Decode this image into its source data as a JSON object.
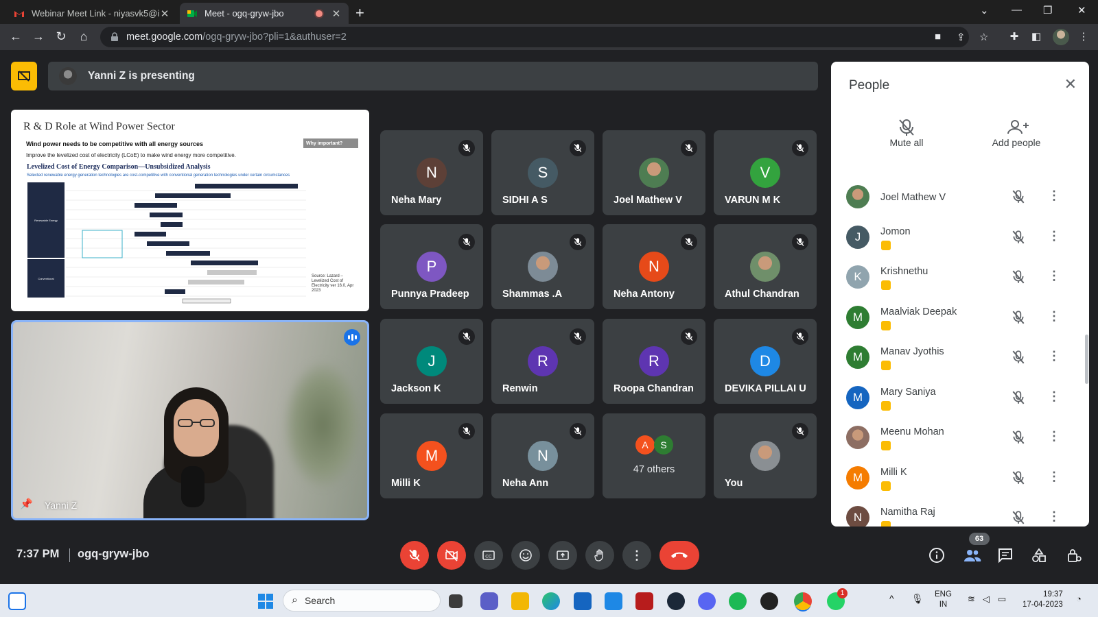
{
  "browser": {
    "tabs": [
      {
        "title": "Webinar Meet Link - niyasvk5@i",
        "active": false
      },
      {
        "title": "Meet - ogq-gryw-jbo",
        "active": true
      }
    ],
    "url_host": "meet.google.com",
    "url_path": "/ogq-gryw-jbo?pli=1&authuser=2"
  },
  "presenting": {
    "text": "Yanni Z is presenting"
  },
  "slide": {
    "title": "R & D Role at Wind Power Sector",
    "line1": "Wind power needs to be competitive with all energy sources",
    "line2": "Improve the levelized cost of electricity (LCoE) to make wind energy more competitive.",
    "chart_title": "Levelized Cost of Energy Comparison—Unsubsidized Analysis",
    "subtitle": "Selected renewable energy generation technologies are cost-competitive with conventional generation technologies under certain circumstances",
    "why_label": "Why important?",
    "source": "Source: Lazard – Levelized Cost of Electricity ver 16.0, Apr 2023",
    "cat_renewable": "Renewable Energy",
    "cat_conventional": "Conventional",
    "axis_label": "Levelized Cost of Energy ($/MWh)"
  },
  "presenter_tile": {
    "name": "Yanni Z"
  },
  "tiles": [
    {
      "name": "Neha Mary",
      "initial": "N",
      "color": "#5d4037",
      "muted": true
    },
    {
      "name": "SIDHI A S",
      "initial": "S",
      "color": "#455a64",
      "muted": true
    },
    {
      "name": "Joel Mathew V",
      "initial": "",
      "color": "#4e7d52",
      "muted": true,
      "photo": true
    },
    {
      "name": "VARUN M K",
      "initial": "V",
      "color": "#33a33e",
      "muted": true
    },
    {
      "name": "Punnya Pradeep",
      "initial": "P",
      "color": "#7e57c2",
      "muted": true
    },
    {
      "name": "Shammas .A",
      "initial": "",
      "color": "#7d8b96",
      "muted": true,
      "photo": true
    },
    {
      "name": "Neha Antony",
      "initial": "N",
      "color": "#e64a19",
      "muted": true
    },
    {
      "name": "Athul Chandran",
      "initial": "",
      "color": "#6f8f6a",
      "muted": true,
      "photo": true
    },
    {
      "name": "Jackson K",
      "initial": "J",
      "color": "#00897b",
      "muted": true
    },
    {
      "name": "Renwin",
      "initial": "R",
      "color": "#5e35b1",
      "muted": true
    },
    {
      "name": "Roopa Chandran",
      "initial": "R",
      "color": "#5e35b1",
      "muted": true
    },
    {
      "name": "DEVIKA PILLAI U",
      "initial": "D",
      "color": "#1e88e5",
      "muted": true
    },
    {
      "name": "Milli K",
      "initial": "M",
      "color": "#f4511e",
      "muted": true
    },
    {
      "name": "Neha Ann",
      "initial": "N",
      "color": "#78909c",
      "muted": true
    },
    {
      "name": "47 others",
      "initial": "",
      "color": "",
      "muted": false,
      "others": true,
      "others_initials": [
        "A",
        "S"
      ]
    },
    {
      "name": "You",
      "initial": "",
      "color": "#8a8f93",
      "muted": true,
      "photo": true
    }
  ],
  "people_panel": {
    "title": "People",
    "mute_all": "Mute all",
    "add_people": "Add people",
    "participants": [
      {
        "name": "Joel Mathew V",
        "initial": "",
        "color": "#4e7d52",
        "photo": true,
        "hand": false
      },
      {
        "name": "Jomon",
        "initial": "J",
        "color": "#455a64",
        "hand": true
      },
      {
        "name": "Krishnethu",
        "initial": "K",
        "color": "#90a4ae",
        "hand": true
      },
      {
        "name": "Maalviak Deepak",
        "initial": "M",
        "color": "#2e7d32",
        "hand": true
      },
      {
        "name": "Manav Jyothis",
        "initial": "M",
        "color": "#2e7d32",
        "hand": true
      },
      {
        "name": "Mary Saniya",
        "initial": "M",
        "color": "#1565c0",
        "hand": true
      },
      {
        "name": "Meenu Mohan",
        "initial": "",
        "color": "#8d6e63",
        "photo": true,
        "hand": true
      },
      {
        "name": "Milli K",
        "initial": "M",
        "color": "#f57c00",
        "hand": true
      },
      {
        "name": "Namitha Raj",
        "initial": "N",
        "color": "#6d4c41",
        "hand": true
      }
    ]
  },
  "bottom": {
    "time": "7:37 PM",
    "meeting_code": "ogq-gryw-jbo",
    "people_count": "63"
  },
  "taskbar": {
    "search_placeholder": "Search",
    "lang_line1": "ENG",
    "lang_line2": "IN",
    "clock_time": "19:37",
    "clock_date": "17-04-2023",
    "whatsapp_badge": "1"
  },
  "colors": {
    "accent": "#8ab4f8",
    "danger": "#ea4335",
    "hand": "#fbbc04",
    "tile": "#3c4043",
    "bg": "#202124"
  }
}
